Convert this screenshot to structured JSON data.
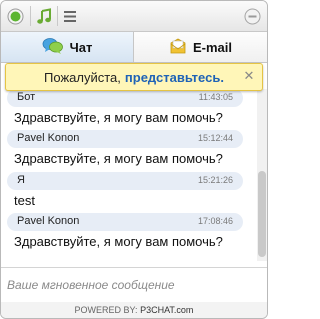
{
  "tabs": [
    {
      "label": "Чат",
      "icon": "chat-bubbles-icon",
      "active": true
    },
    {
      "label": "E-mail",
      "icon": "email-icon",
      "active": false
    }
  ],
  "notice": {
    "text": "Пожалуйста,",
    "link": "представьтесь."
  },
  "messages": [
    {
      "author": "Бот",
      "time": "11:43:05",
      "text": "Здравствуйте, я могу вам помочь?"
    },
    {
      "author": "Pavel Konon",
      "time": "15:12:44",
      "text": "Здравствуйте, я могу вам помочь?"
    },
    {
      "author": "Я",
      "time": "15:21:26",
      "text": "test"
    },
    {
      "author": "Pavel Konon",
      "time": "17:08:46",
      "text": "Здравствуйте, я могу вам помочь?"
    }
  ],
  "input": {
    "placeholder": "Ваше мгновенное сообщение"
  },
  "footer": {
    "powered_by": "POWERED BY:",
    "brand": "P3CHAT.com"
  },
  "toolbar": {
    "icons": [
      "status-online-icon",
      "sound-icon",
      "menu-icon",
      "minimize-icon"
    ]
  },
  "colors": {
    "accent_link": "#1f63b6",
    "notice_bg": "#fff6b8",
    "online_green": "#5cb531"
  }
}
